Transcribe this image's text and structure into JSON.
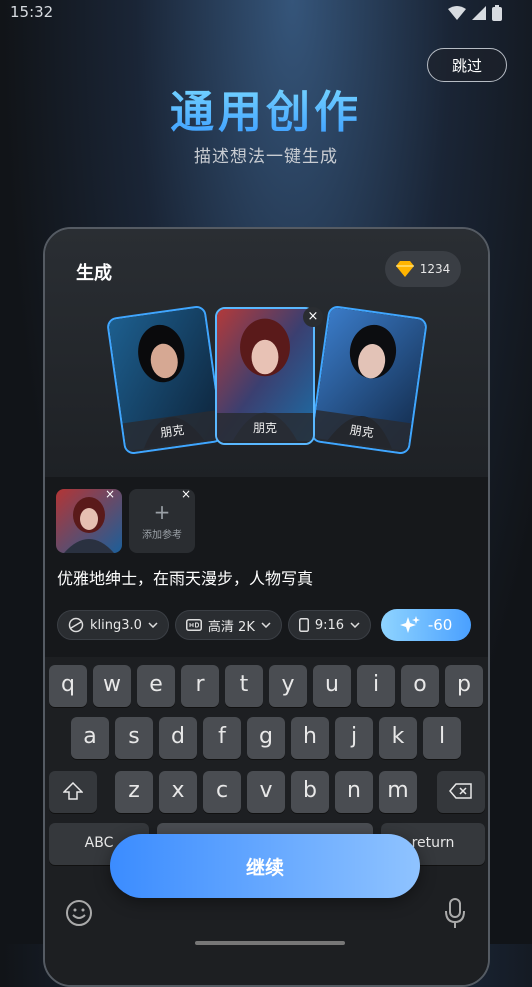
{
  "status": {
    "time": "15:32"
  },
  "skip_label": "跳过",
  "hero": {
    "title": "通用创作",
    "subtitle": "描述想法一键生成"
  },
  "panel": {
    "title": "生成",
    "credits": "1234",
    "cards": [
      {
        "label": "朋克"
      },
      {
        "label": "朋克"
      },
      {
        "label": "朋克"
      }
    ],
    "card_close": "×",
    "add_reference_label": "添加参考",
    "prompt": "优雅地绅士，在雨天漫步，人物写真",
    "chips": {
      "model": "kling3.0",
      "quality": "高清 2K",
      "ratio": "9:16"
    },
    "generate_cost": "-60"
  },
  "keyboard": {
    "row1": [
      "q",
      "w",
      "e",
      "r",
      "t",
      "y",
      "u",
      "i",
      "o",
      "p"
    ],
    "row2": [
      "a",
      "s",
      "d",
      "f",
      "g",
      "h",
      "j",
      "k",
      "l"
    ],
    "row3": [
      "z",
      "x",
      "c",
      "v",
      "b",
      "n",
      "m"
    ],
    "abc_label": "ABC",
    "return_label": "return"
  },
  "continue_label": "继续",
  "colors": {
    "accent": "#4aa0ff",
    "title_gradient_top": "#7fdcff"
  }
}
